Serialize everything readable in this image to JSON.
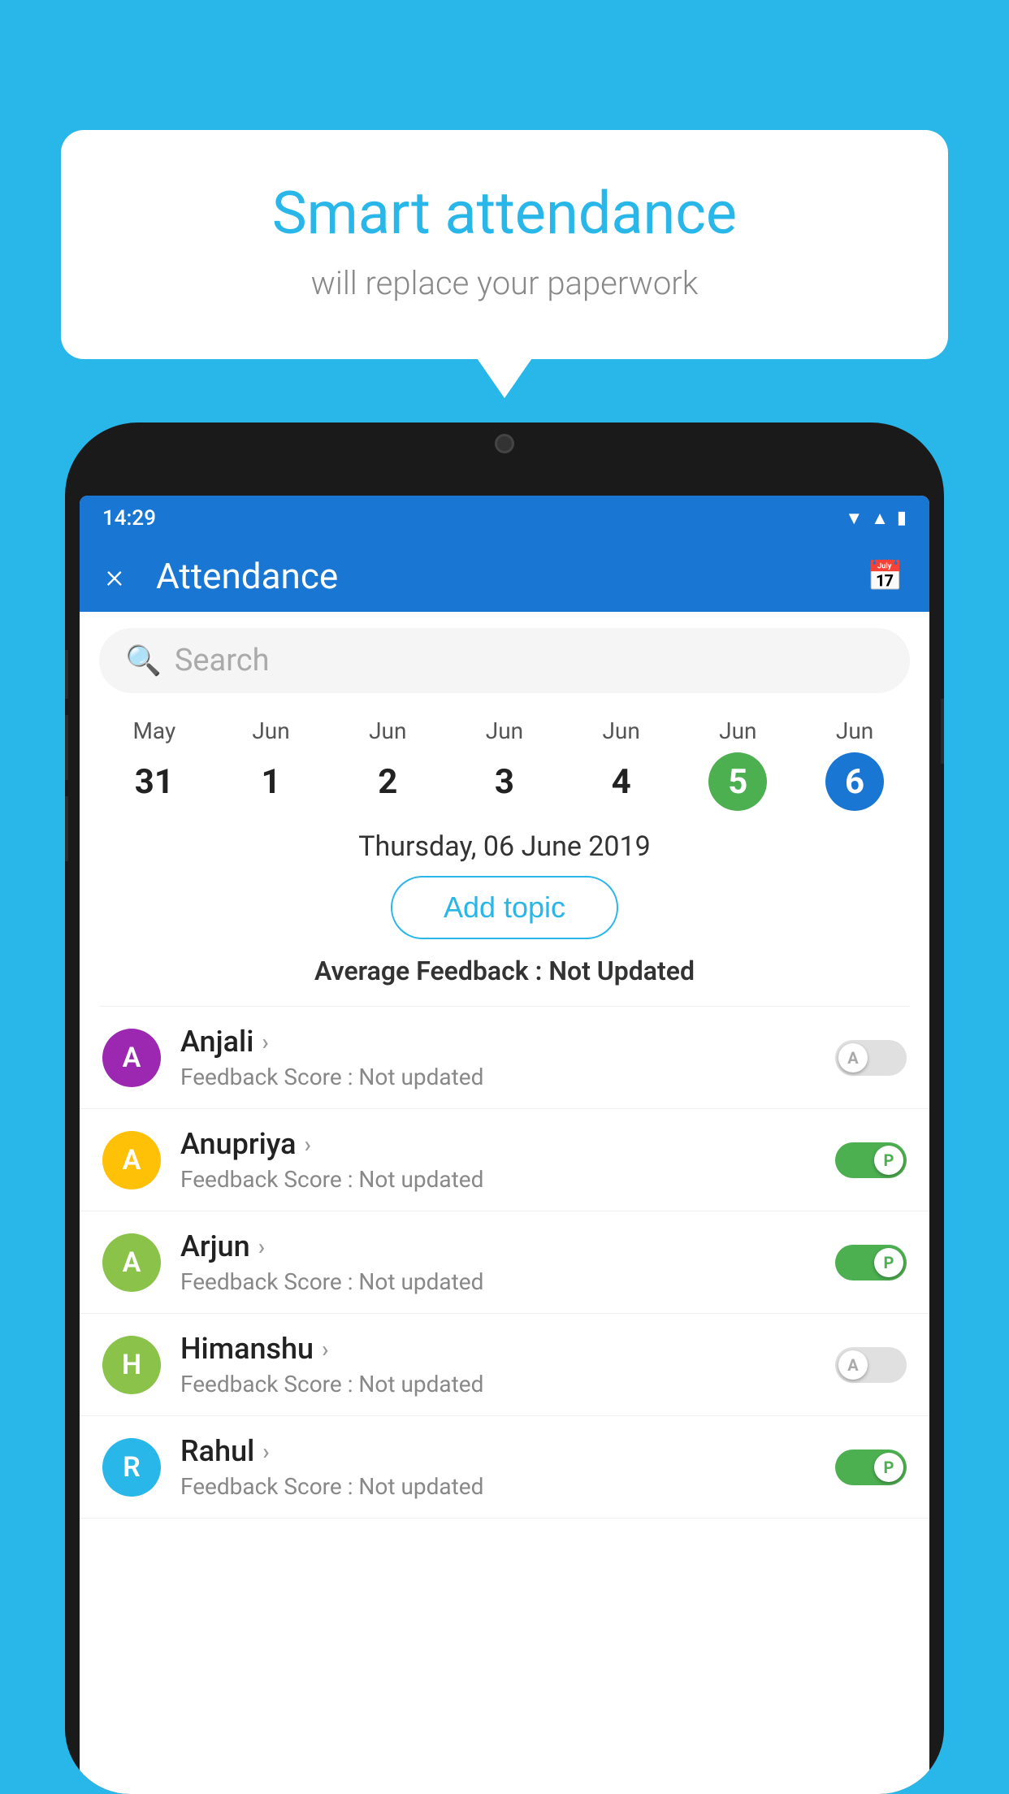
{
  "background_color": "#29b6e8",
  "speech_bubble": {
    "title": "Smart attendance",
    "subtitle": "will replace your paperwork"
  },
  "status_bar": {
    "time": "14:29",
    "icons": [
      "wifi",
      "signal",
      "battery"
    ]
  },
  "app_bar": {
    "close_label": "×",
    "title": "Attendance",
    "calendar_icon": "📅"
  },
  "search": {
    "placeholder": "Search"
  },
  "calendar": {
    "days": [
      {
        "month": "May",
        "date": "31",
        "style": "normal"
      },
      {
        "month": "Jun",
        "date": "1",
        "style": "normal"
      },
      {
        "month": "Jun",
        "date": "2",
        "style": "normal"
      },
      {
        "month": "Jun",
        "date": "3",
        "style": "normal"
      },
      {
        "month": "Jun",
        "date": "4",
        "style": "normal"
      },
      {
        "month": "Jun",
        "date": "5",
        "style": "today"
      },
      {
        "month": "Jun",
        "date": "6",
        "style": "selected"
      }
    ]
  },
  "selected_date_label": "Thursday, 06 June 2019",
  "add_topic_label": "Add topic",
  "avg_feedback_prefix": "Average Feedback : ",
  "avg_feedback_value": "Not Updated",
  "students": [
    {
      "name": "Anjali",
      "avatar_letter": "A",
      "avatar_color": "#9c27b0",
      "feedback": "Feedback Score : Not updated",
      "toggle_state": "off",
      "toggle_label": "A"
    },
    {
      "name": "Anupriya",
      "avatar_letter": "A",
      "avatar_color": "#ffc107",
      "feedback": "Feedback Score : Not updated",
      "toggle_state": "on",
      "toggle_label": "P"
    },
    {
      "name": "Arjun",
      "avatar_letter": "A",
      "avatar_color": "#8bc34a",
      "feedback": "Feedback Score : Not updated",
      "toggle_state": "on",
      "toggle_label": "P"
    },
    {
      "name": "Himanshu",
      "avatar_letter": "H",
      "avatar_color": "#8bc34a",
      "feedback": "Feedback Score : Not updated",
      "toggle_state": "off",
      "toggle_label": "A"
    },
    {
      "name": "Rahul",
      "avatar_letter": "R",
      "avatar_color": "#29b6e8",
      "feedback": "Feedback Score : Not updated",
      "toggle_state": "on",
      "toggle_label": "P"
    }
  ]
}
